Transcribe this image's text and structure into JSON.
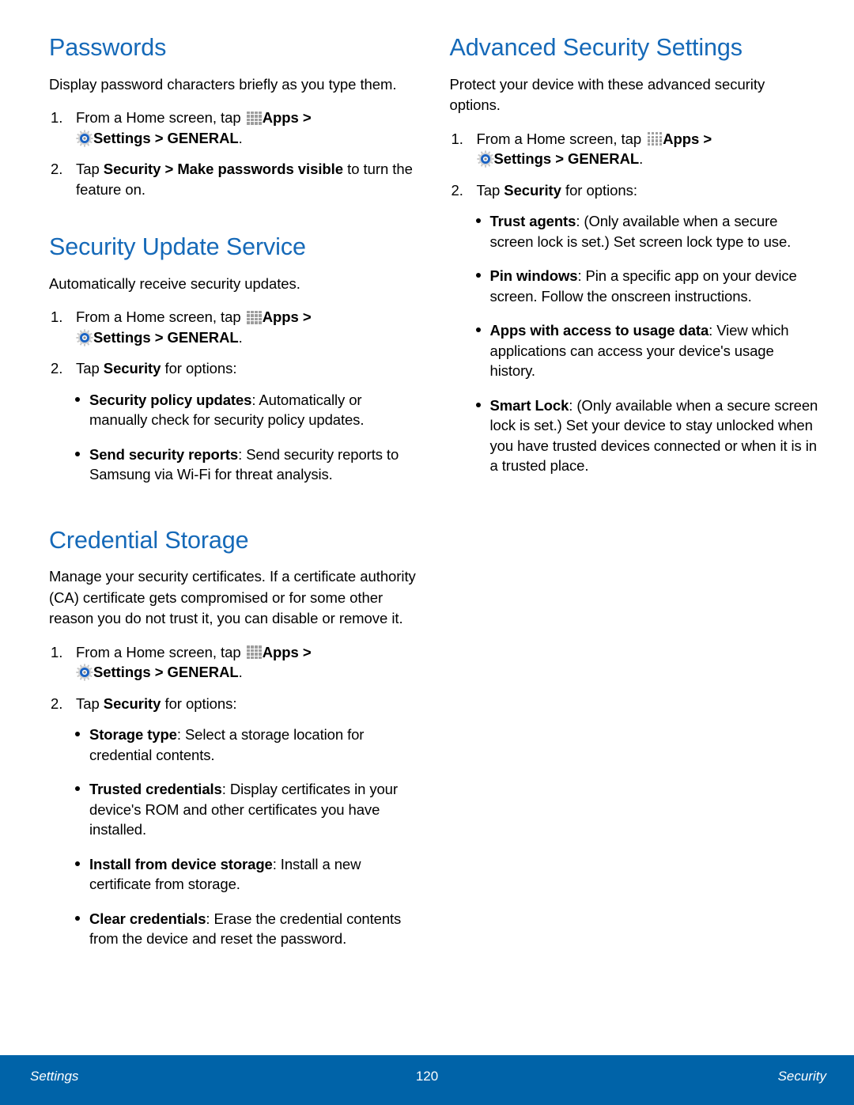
{
  "page": {
    "number": "120",
    "footer_left": "Settings",
    "footer_right": "Security",
    "accent_heading_color": "#1569b8",
    "footer_bar_color": "#0063a8"
  },
  "icons": {
    "apps": "apps-grid-icon",
    "settings": "settings-gear-icon"
  },
  "common": {
    "step1_lead": "From a Home screen, tap",
    "step1_apps": "Apps",
    "step1_sep1": ">",
    "step1_settings": "Settings",
    "step1_sep2": ">",
    "step1_general": "GENERAL",
    "step1_period": ".",
    "step2_tap": "Tap",
    "step2_security": "Security",
    "step2_for_options": "for options:",
    "num1": "1.",
    "num2": "2."
  },
  "left_column": {
    "sections": [
      {
        "title": "Passwords",
        "intro": "Display password characters briefly as you type them.",
        "step2_kind": "make_visible",
        "step2_tap": "Tap",
        "step2_bold_a": "Security > Make passwords visible",
        "step2_tail": "to turn the feature on.",
        "bullets": []
      },
      {
        "title": "Security Update Service",
        "intro": "Automatically receive security updates.",
        "step2_kind": "options",
        "bullets": [
          {
            "term": "Security policy updates",
            "desc": ": Automatically or manually check for security policy updates."
          },
          {
            "term": "Send security reports",
            "desc": ": Send security reports to Samsung via Wi-Fi for threat analysis."
          }
        ]
      },
      {
        "title": "Credential Storage",
        "intro": "Manage your security certificates. If a certificate authority (CA) certificate gets compromised or for some other reason you do not trust it, you can disable or remove it.",
        "step2_kind": "options",
        "bullets": [
          {
            "term": "Storage type",
            "desc": ": Select a storage location for credential contents."
          },
          {
            "term": "Trusted credentials",
            "desc": ": Display certificates in your device's ROM and other certificates you have installed."
          },
          {
            "term": "Install from device storage",
            "desc": ": Install a new certificate from storage."
          },
          {
            "term": "Clear credentials",
            "desc": ": Erase the credential contents from the device and reset the password."
          }
        ]
      }
    ]
  },
  "right_column": {
    "sections": [
      {
        "title": "Advanced Security Settings",
        "intro": "Protect your device with these advanced security options.",
        "step2_kind": "options",
        "bullets": [
          {
            "term": "Trust agents",
            "desc": ": (Only available when a secure screen lock is set.) Set screen lock type to use."
          },
          {
            "term": "Pin windows",
            "desc": ": Pin a specific app on your device screen. Follow the onscreen instructions."
          },
          {
            "term": "Apps with access to usage data",
            "desc": ": View which applications can access your device's usage history."
          },
          {
            "term": "Smart Lock",
            "desc": ": (Only available when a secure screen lock is set.) Set your device to stay unlocked when you have trusted devices connected or when it is in a trusted place."
          }
        ]
      }
    ]
  }
}
